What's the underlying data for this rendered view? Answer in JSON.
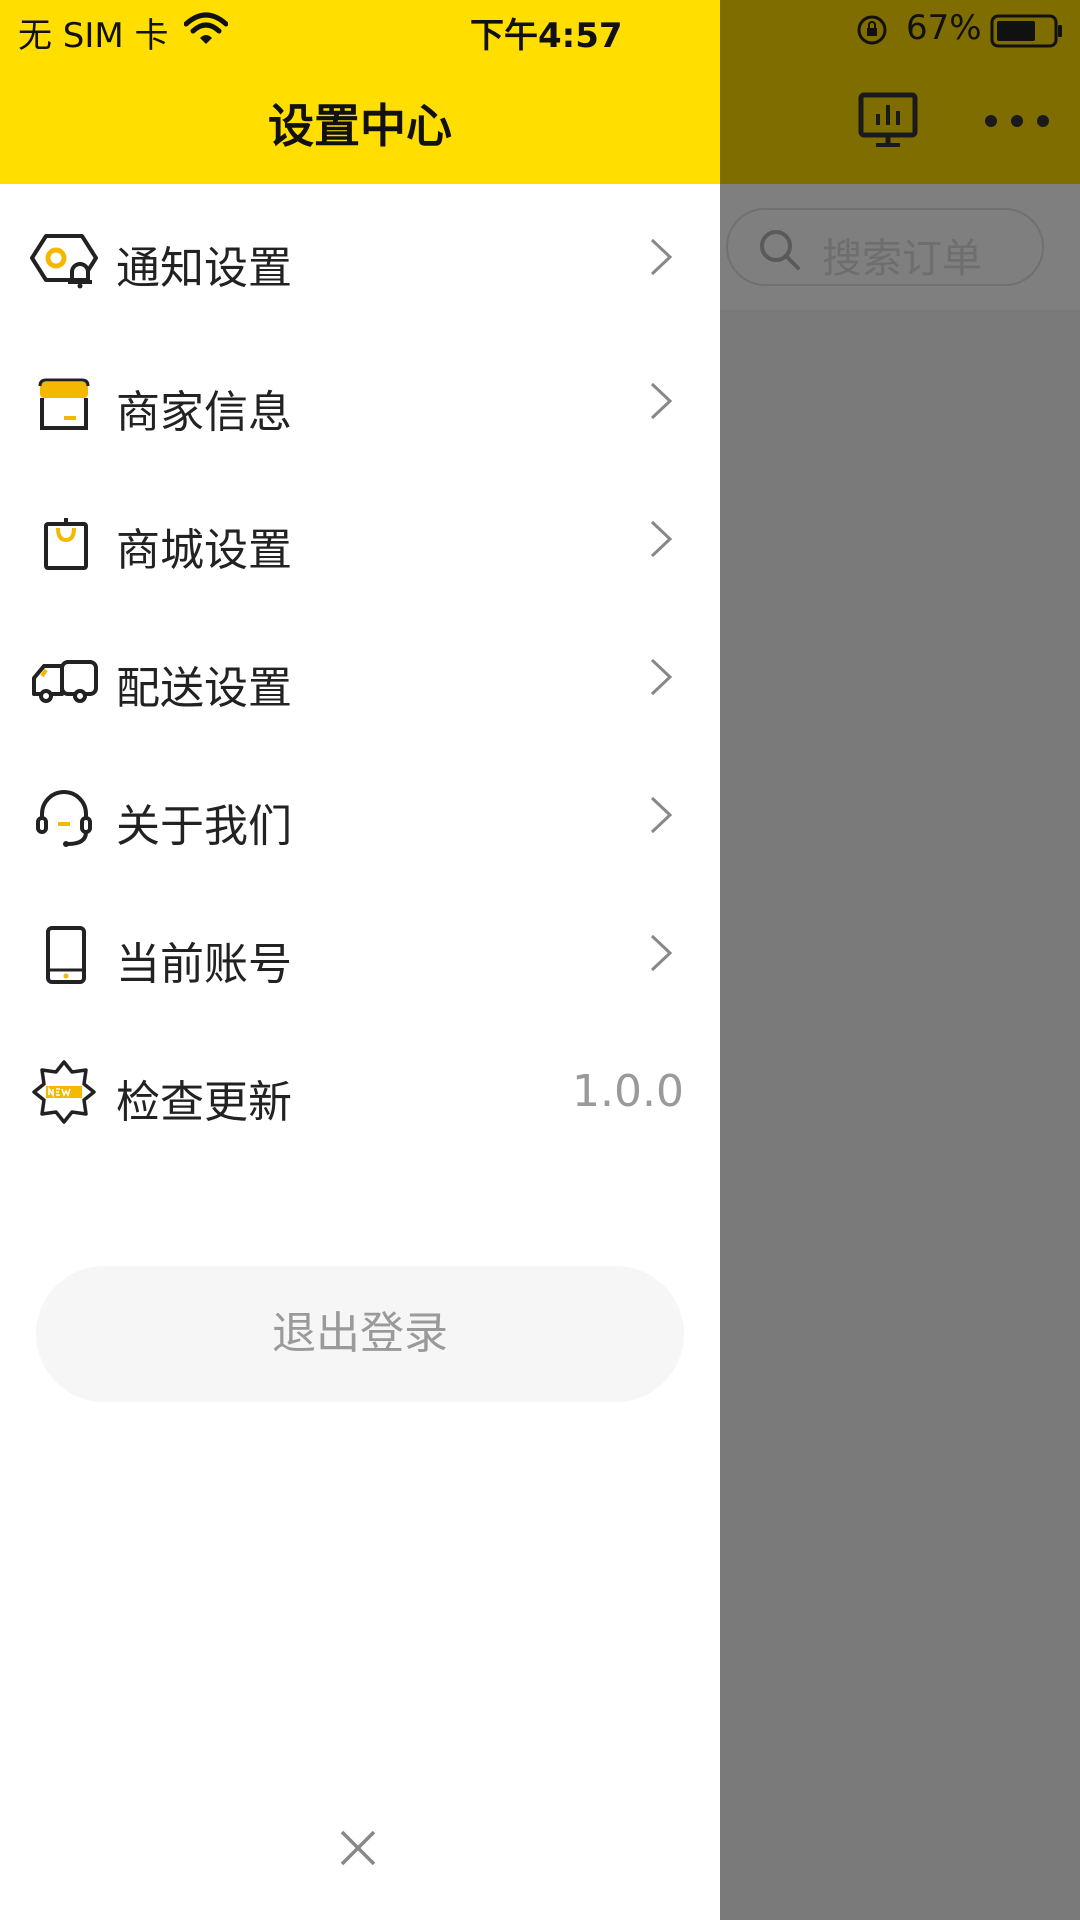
{
  "status_bar": {
    "carrier": "无 SIM 卡",
    "time": "下午4:57",
    "battery": "67%"
  },
  "drawer": {
    "title": "设置中心",
    "items": [
      {
        "label": "通知设置",
        "icon": "notification-settings-icon"
      },
      {
        "label": "商家信息",
        "icon": "store-icon"
      },
      {
        "label": "商城设置",
        "icon": "shopping-bag-icon"
      },
      {
        "label": "配送设置",
        "icon": "delivery-truck-icon"
      },
      {
        "label": "关于我们",
        "icon": "headset-icon"
      },
      {
        "label": "当前账号",
        "icon": "tablet-icon"
      },
      {
        "label": "检查更新",
        "icon": "new-badge-icon",
        "value": "1.0.0"
      }
    ],
    "logout_label": "退出登录"
  },
  "background": {
    "search_placeholder": "搜索订单"
  },
  "colors": {
    "accent": "#ffde00",
    "overlay": "#7a7a7a"
  }
}
